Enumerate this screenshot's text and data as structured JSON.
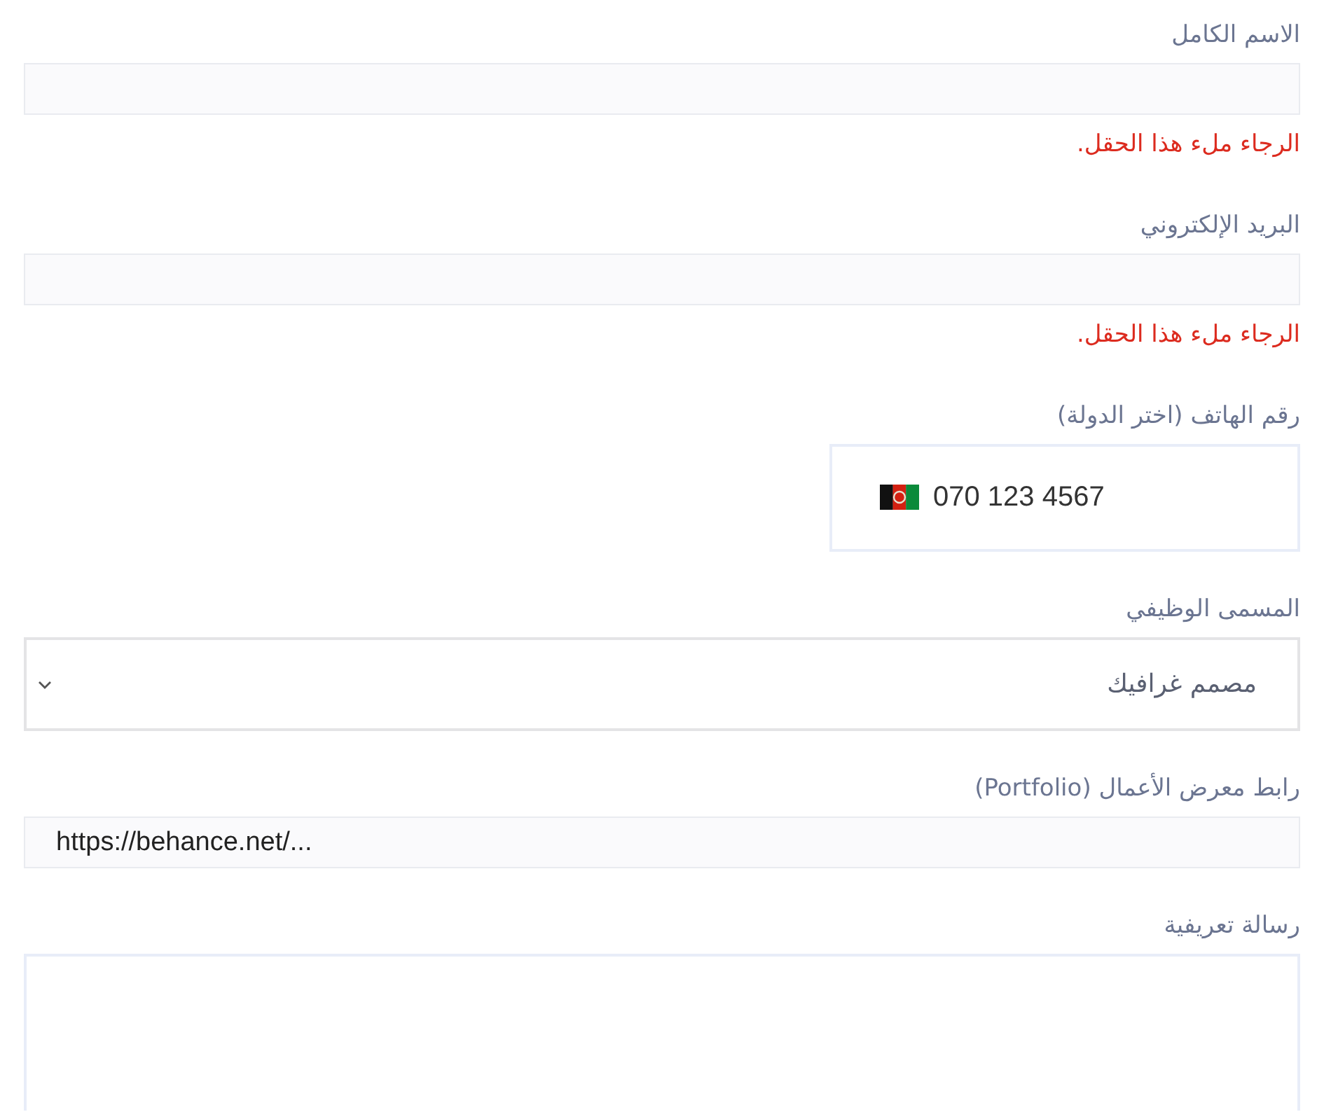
{
  "fields": [
    {
      "kind": "text",
      "label": "الاسم الكامل",
      "error": "الرجاء ملء هذا الحقل."
    },
    {
      "kind": "text",
      "label": "البريد الإلكتروني",
      "error": "الرجاء ملء هذا الحقل."
    },
    {
      "kind": "phone",
      "label": "رقم الهاتف (اختر الدولة)",
      "placeholder": "070 123 4567"
    },
    {
      "kind": "select",
      "label": "المسمى الوظيفي",
      "value": "مصمم غرافيك"
    },
    {
      "kind": "url",
      "label": "رابط معرض الأعمال (Portfolio)",
      "placeholder": "https://behance.net/..."
    },
    {
      "kind": "textarea",
      "label": "رسالة تعريفية"
    }
  ]
}
